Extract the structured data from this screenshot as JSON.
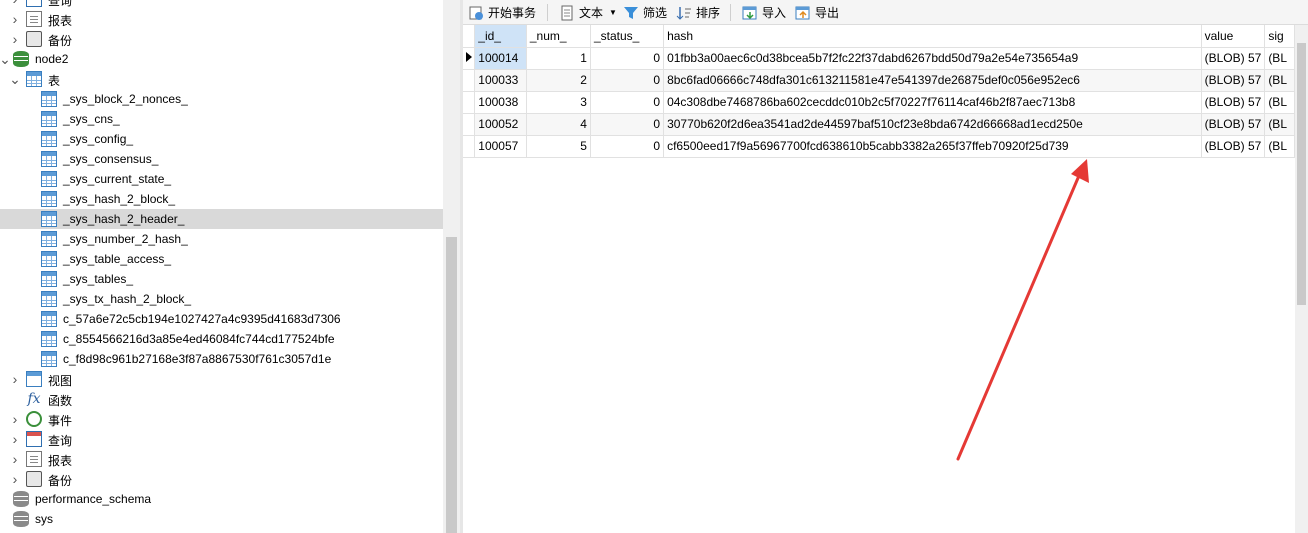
{
  "tree": {
    "items": [
      {
        "label": "查询",
        "icon": "query-icon",
        "chevron": ">"
      },
      {
        "label": "报表",
        "icon": "report-icon",
        "chevron": ">"
      },
      {
        "label": "备份",
        "icon": "backup-icon",
        "chevron": ">"
      },
      {
        "label": "node2",
        "icon": "database-icon",
        "chevron": "v"
      },
      {
        "label": "表",
        "icon": "tables-folder-icon",
        "chevron": "v"
      },
      {
        "label": "_sys_block_2_nonces_",
        "icon": "table-icon"
      },
      {
        "label": "_sys_cns_",
        "icon": "table-icon"
      },
      {
        "label": "_sys_config_",
        "icon": "table-icon"
      },
      {
        "label": "_sys_consensus_",
        "icon": "table-icon"
      },
      {
        "label": "_sys_current_state_",
        "icon": "table-icon"
      },
      {
        "label": "_sys_hash_2_block_",
        "icon": "table-icon"
      },
      {
        "label": "_sys_hash_2_header_",
        "icon": "table-icon",
        "selected": true
      },
      {
        "label": "_sys_number_2_hash_",
        "icon": "table-icon"
      },
      {
        "label": "_sys_table_access_",
        "icon": "table-icon"
      },
      {
        "label": "_sys_tables_",
        "icon": "table-icon"
      },
      {
        "label": "_sys_tx_hash_2_block_",
        "icon": "table-icon"
      },
      {
        "label": "c_57a6e72c5cb194e1027427a4c9395d41683d7306",
        "icon": "table-icon"
      },
      {
        "label": "c_8554566216d3a85e4ed46084fc744cd177524bfe",
        "icon": "table-icon"
      },
      {
        "label": "c_f8d98c961b27168e3f87a8867530f761c3057d1e",
        "icon": "table-icon"
      },
      {
        "label": "视图",
        "icon": "view-icon",
        "chevron": ">"
      },
      {
        "label": "函数",
        "icon": "function-icon"
      },
      {
        "label": "事件",
        "icon": "event-icon",
        "chevron": ">"
      },
      {
        "label": "查询",
        "icon": "query-icon",
        "chevron": ">"
      },
      {
        "label": "报表",
        "icon": "report-icon",
        "chevron": ">"
      },
      {
        "label": "备份",
        "icon": "backup-icon",
        "chevron": ">"
      },
      {
        "label": "performance_schema",
        "icon": "database-icon-grey"
      },
      {
        "label": "sys",
        "icon": "database-icon-grey"
      }
    ]
  },
  "toolbar": {
    "begin_transaction": "开始事务",
    "text": "文本",
    "filter": "筛选",
    "sort": "排序",
    "import": "导入",
    "export": "导出"
  },
  "grid": {
    "columns": [
      "_id_",
      "_num_",
      "_status_",
      "hash",
      "value",
      "sig"
    ],
    "rows": [
      {
        "id": "100014",
        "num": "1",
        "status": "0",
        "hash": "01fbb3a00aec6c0d38bcea5b7f2fc22f37dabd6267bdd50d79a2e54e735654a9",
        "value": "(BLOB) 57",
        "sig": "(BL"
      },
      {
        "id": "100033",
        "num": "2",
        "status": "0",
        "hash": "8bc6fad06666c748dfa301c613211581e47e541397de26875def0c056e952ec6",
        "value": "(BLOB) 57",
        "sig": "(BL"
      },
      {
        "id": "100038",
        "num": "3",
        "status": "0",
        "hash": "04c308dbe7468786ba602cecddc010b2c5f70227f76114caf46b2f87aec713b8",
        "value": "(BLOB) 57",
        "sig": "(BL"
      },
      {
        "id": "100052",
        "num": "4",
        "status": "0",
        "hash": "30770b620f2d6ea3541ad2de44597baf510cf23e8bda6742d66668ad1ecd250e",
        "value": "(BLOB) 57",
        "sig": "(BL"
      },
      {
        "id": "100057",
        "num": "5",
        "status": "0",
        "hash": "cf6500eed17f9a56967700fcd638610b5cabb3382a265f37ffeb70920f25d739",
        "value": "(BLOB) 57",
        "sig": "(BL"
      }
    ]
  },
  "colors": {
    "selection": "#d9d9d9",
    "current_cell": "#cfe3f7",
    "annotation_arrow": "#e53935"
  }
}
